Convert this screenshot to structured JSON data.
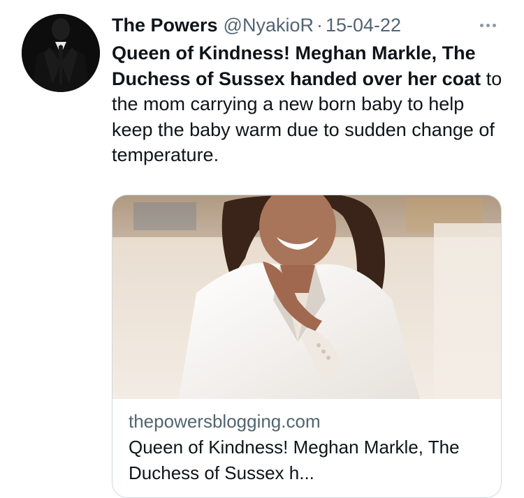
{
  "tweet": {
    "author_name": "The Powers",
    "author_handle": "@NyakioR",
    "separator": "·",
    "date": "15-04-22",
    "avatar_icon": "suited-figure-avatar",
    "more_icon": "more-dots-icon",
    "text_bold": "Queen of Kindness! Meghan Markle, The Duchess of Sussex handed over her coat",
    "text_regular": " to the mom carrying a new born baby to help keep the baby warm due to sudden change of temperature."
  },
  "link_card": {
    "image_subject": "woman-in-white-blazer-photo",
    "domain": "thepowersblogging.com",
    "title": "Queen of Kindness! Meghan Markle, The Duchess of Sussex h..."
  },
  "colors": {
    "text_primary": "#0f1419",
    "text_secondary": "#536471",
    "card_border": "#cfd9de"
  }
}
